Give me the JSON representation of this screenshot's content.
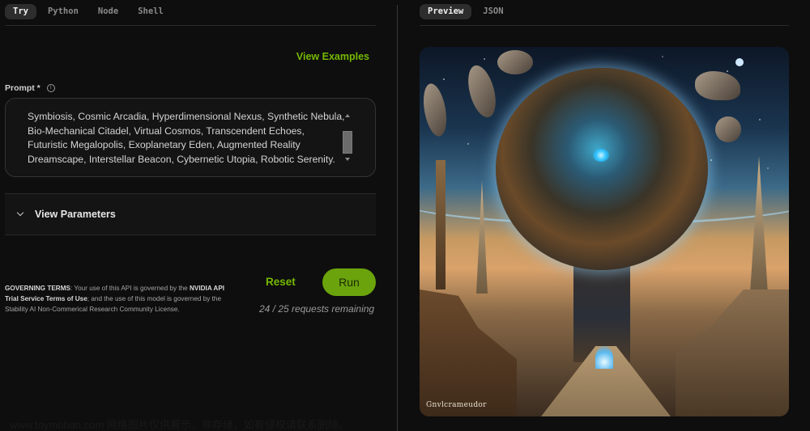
{
  "left_tabs": [
    {
      "label": "Try",
      "active": true
    },
    {
      "label": "Python",
      "active": false
    },
    {
      "label": "Node",
      "active": false
    },
    {
      "label": "Shell",
      "active": false
    }
  ],
  "view_examples_label": "View Examples",
  "prompt": {
    "label": "Prompt *",
    "info_icon": "info-icon",
    "value": "Symbiosis, Cosmic Arcadia, Hyperdimensional Nexus, Synthetic Nebula, Bio-Mechanical Citadel, Virtual Cosmos, Transcendent Echoes, Futuristic Megalopolis, Exoplanetary Eden, Augmented Reality Dreamscape, Interstellar Beacon, Cybernetic Utopia, Robotic Serenity."
  },
  "parameters": {
    "label": "View Parameters",
    "icon": "chevron-down-icon"
  },
  "terms": {
    "lead": "GOVERNING TERMS",
    "text1": ": Your use of this API is governed by the ",
    "link1": "NVIDIA API Trial Service Terms of Use",
    "text2": "; and the use of this model is governed by the ",
    "link2": "Stability AI Non-Commerical Research Community License",
    "text3": "."
  },
  "actions": {
    "reset_label": "Reset",
    "run_label": "Run",
    "remaining_text": "24 / 25 requests remaining",
    "requests_used": 24,
    "requests_total": 25
  },
  "right_tabs": [
    {
      "label": "Preview",
      "active": true
    },
    {
      "label": "JSON",
      "active": false
    }
  ],
  "preview": {
    "alt": "Generated image: giant cracked planet hovering above a futuristic desert city with spires and travelers",
    "signature": "Gnvlcrameudor"
  },
  "watermark": "www.toymoban.com 网络图片仅供展示，非存储，如有侵权请联系删除。",
  "colors": {
    "accent": "#76b900",
    "run_button": "#6aa30c",
    "background": "#0e0e0e"
  }
}
